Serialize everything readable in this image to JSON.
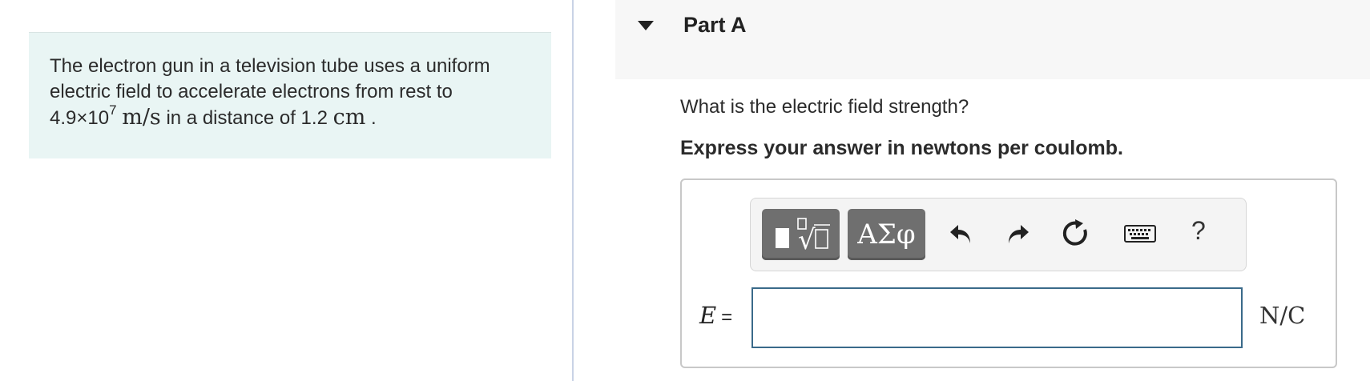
{
  "problem": {
    "line1": "The electron gun in a television tube uses a uniform",
    "line2": "electric field to accelerate electrons from rest to",
    "speed_mantissa": "4.9×10",
    "speed_exponent": "7",
    "speed_unit": "m/s",
    "middle": "in a distance of 1.2",
    "distance_unit": "cm",
    "end": "."
  },
  "part": {
    "title": "Part A",
    "question": "What is the electric field strength?",
    "instruction": "Express your answer in newtons per coulomb."
  },
  "toolbar": {
    "template_icon": "templates-icon",
    "symbols_label": "ΑΣφ",
    "undo_icon": "undo-icon",
    "redo_icon": "redo-icon",
    "reset_icon": "reset-icon",
    "keyboard_icon": "keyboard-icon",
    "help_label": "?"
  },
  "answer": {
    "variable": "E",
    "equals": "=",
    "value": "",
    "unit": "N/C"
  },
  "colors": {
    "problem_bg": "#e9f5f4",
    "toolbar_button": "#6f6f6f",
    "input_border": "#3a6a8a"
  }
}
